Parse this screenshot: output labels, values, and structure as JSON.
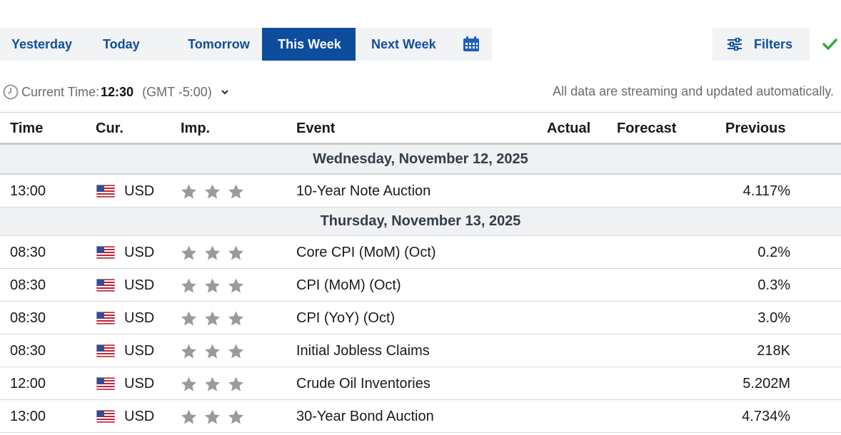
{
  "tabs": {
    "yesterday": "Yesterday",
    "today": "Today",
    "tomorrow": "Tomorrow",
    "this_week": "This Week",
    "next_week": "Next Week",
    "active": "This Week"
  },
  "filters": {
    "label": "Filters"
  },
  "info": {
    "current_time_label": "Current Time:",
    "current_time": "12:30",
    "timezone": "(GMT -5:00)",
    "streaming_note": "All data are streaming and updated automatically."
  },
  "columns": {
    "time": "Time",
    "currency": "Cur.",
    "importance": "Imp.",
    "event": "Event",
    "actual": "Actual",
    "forecast": "Forecast",
    "previous": "Previous"
  },
  "days": [
    {
      "date": "Wednesday, November 12, 2025",
      "events": [
        {
          "time": "13:00",
          "currency": "USD",
          "importance": 3,
          "event": "10-Year Note Auction",
          "actual": "",
          "forecast": "",
          "previous": "4.117%"
        }
      ]
    },
    {
      "date": "Thursday, November 13, 2025",
      "events": [
        {
          "time": "08:30",
          "currency": "USD",
          "importance": 3,
          "event": "Core CPI (MoM) (Oct)",
          "actual": "",
          "forecast": "",
          "previous": "0.2%"
        },
        {
          "time": "08:30",
          "currency": "USD",
          "importance": 3,
          "event": "CPI (MoM) (Oct)",
          "actual": "",
          "forecast": "",
          "previous": "0.3%"
        },
        {
          "time": "08:30",
          "currency": "USD",
          "importance": 3,
          "event": "CPI (YoY) (Oct)",
          "actual": "",
          "forecast": "",
          "previous": "3.0%"
        },
        {
          "time": "08:30",
          "currency": "USD",
          "importance": 3,
          "event": "Initial Jobless Claims",
          "actual": "",
          "forecast": "",
          "previous": "218K"
        },
        {
          "time": "12:00",
          "currency": "USD",
          "importance": 3,
          "event": "Crude Oil Inventories",
          "actual": "",
          "forecast": "",
          "previous": "5.202M"
        },
        {
          "time": "13:00",
          "currency": "USD",
          "importance": 3,
          "event": "30-Year Bond Auction",
          "actual": "",
          "forecast": "",
          "previous": "4.734%"
        }
      ]
    }
  ],
  "icons": {
    "calendar": "calendar-icon",
    "filters": "sliders-icon",
    "check": "check-icon",
    "clock": "clock-icon",
    "flag": "us-flag-icon",
    "star": "star-icon"
  },
  "colors": {
    "brand_blue": "#0f4e9e",
    "active_tab_bg": "#0e4c9c",
    "check_green": "#2eaa3a",
    "star_gray": "#9a9a9a"
  }
}
